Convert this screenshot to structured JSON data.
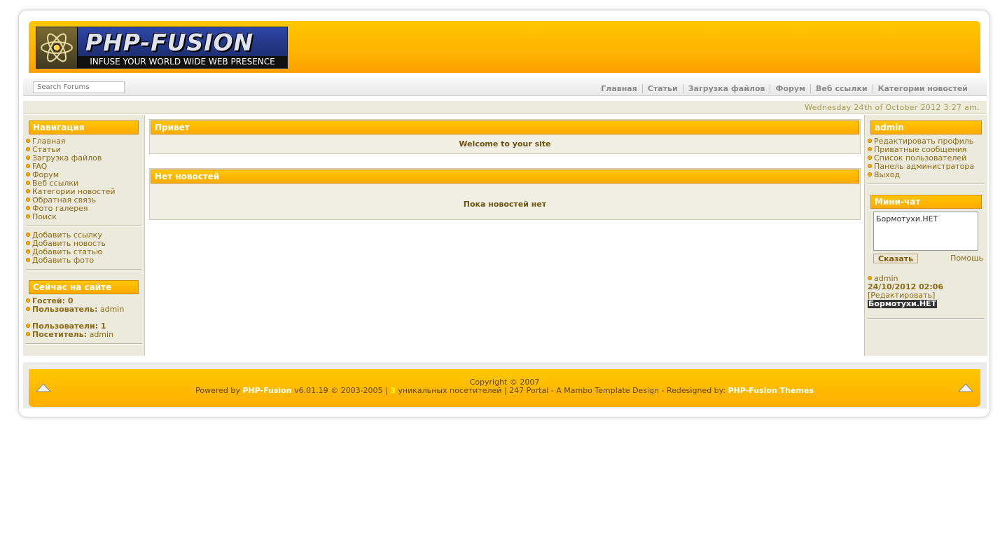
{
  "header": {
    "logo_title": "PHP-FUSION",
    "logo_tagline": "INFUSE YOUR WORLD WIDE WEB PRESENCE"
  },
  "search": {
    "placeholder": "Search Forums"
  },
  "topnav": [
    "Главная",
    "Статьи",
    "Загрузка файлов",
    "Форум",
    "Веб ссылки",
    "Категории новостей"
  ],
  "date": "Wednesday 24th of October 2012 3:27 am.",
  "left": {
    "nav_title": "Навигация",
    "nav_items": [
      "Главная",
      "Статьи",
      "Загрузка файлов",
      "FAQ",
      "Форум",
      "Веб ссылки",
      "Категории новостей",
      "Обратная связь",
      "Фото галерея",
      "Поиск"
    ],
    "submit_items": [
      "Добавить ссылку",
      "Добавить новость",
      "Добавить статью",
      "Добавить фото"
    ],
    "online_title": "Сейчас на сайте",
    "guests_label": "Гостей: 0",
    "user_label": "Пользователь:",
    "user_name": "admin",
    "users_count_label": "Пользователи: 1",
    "visitor_label": "Посетитель:",
    "visitor_name": "admin"
  },
  "center": {
    "welcome_title": "Привет",
    "welcome_text": "Welcome to your site",
    "news_title": "Нет новостей",
    "news_text": "Пока новостей нет"
  },
  "right": {
    "user_title": "admin",
    "user_items": [
      "Редактировать профиль",
      "Приватные сообщения",
      "Список пользователей",
      "Панель администратора",
      "Выход"
    ],
    "chat_title": "Мини-чат",
    "chat_value": "Бормотухи.НЕТ",
    "say_label": "Сказать",
    "help_label": "Помощь",
    "shout_author": "admin",
    "shout_date": "24/10/2012 02:06",
    "shout_edit": "[Редактировать]",
    "shout_message": "Бормотухи.НЕТ"
  },
  "footer": {
    "copyright": "Copyright © 2007",
    "powered_prefix": "Powered by ",
    "powered_link": "PHP-Fusion",
    "powered_version": " v6.01.19 © 2003-2005 | ",
    "visitors_count": "3",
    "visitors_suffix": " уникальных посетителей | 247 Portal - A Mambo Template Design - Redesigned by: ",
    "themes_link": "PHP-Fusion Themes"
  },
  "colors": {
    "accent_orange": "#ffb300",
    "sidebar_bg": "#ebeadc",
    "text_brown": "#7a5a10"
  }
}
